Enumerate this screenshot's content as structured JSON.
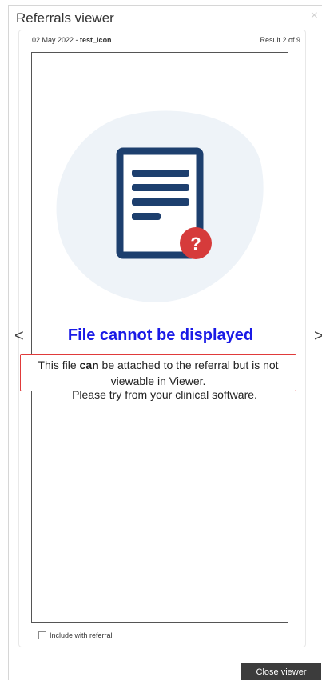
{
  "window": {
    "title": "Referrals viewer",
    "close_glyph": "×"
  },
  "header": {
    "date": "02 May 2022",
    "separator": " - ",
    "filename": "test_icon",
    "result": "Result 2 of 9"
  },
  "viewer": {
    "icon": "document-question-icon",
    "error_title": "File cannot be displayed",
    "message_part1": "This file ",
    "message_bold": "can",
    "message_part2": " be attached to the referral but is not viewable in Viewer.",
    "message_line2": "Please try from your clinical software.",
    "highlight_color": "#e03a3a"
  },
  "navigation": {
    "prev_glyph": "<",
    "next_glyph": ">"
  },
  "footer": {
    "include_label": "Include with referral",
    "include_checked": false,
    "close_button": "Close viewer"
  },
  "colors": {
    "title_blue": "#1a1ae6",
    "icon_navy": "#1d3f6e",
    "badge_red": "#d63b3b",
    "blob": "#eef3f8",
    "button_bg": "#3c3c3c"
  }
}
